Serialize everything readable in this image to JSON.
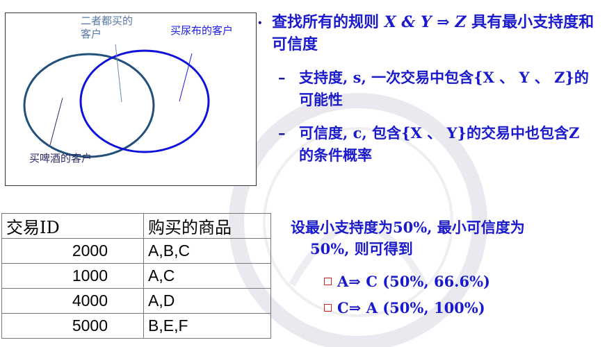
{
  "venn": {
    "label_both": "二者都买的客户",
    "label_diaper": "买尿布的客户",
    "label_beer": "买啤酒的客户",
    "colors": {
      "beer_circle": "#1f4f7a",
      "diaper_circle": "#1010dd"
    }
  },
  "rules": {
    "bullet": "•",
    "main_prefix": "查找所有的规则",
    "main_formula": "X & Y ⇒ Z",
    "main_suffix": "具有最小支持度和可信度",
    "support_dash": "–",
    "support_text": "支持度, s, 一次交易中包含{X 、 Y 、 Z}的可能性",
    "confidence_dash": "–",
    "confidence_text": "可信度, c, 包含{X 、 Y}的交易中也包含Z的条件概率"
  },
  "table": {
    "headers": [
      "交易ID",
      "购买的商品"
    ],
    "rows": [
      {
        "id": "2000",
        "items": "A,B,C"
      },
      {
        "id": "1000",
        "items": "A,C"
      },
      {
        "id": "4000",
        "items": "A,D"
      },
      {
        "id": "5000",
        "items": "B,E,F"
      }
    ]
  },
  "result": {
    "line1": "设最小支持度为50%, 最小可信度为",
    "line2": "50%, 则可得到",
    "rule1": "A⇒  C  (50%, 66.6%)",
    "rule2": "C⇒  A  (50%, 100%)"
  }
}
